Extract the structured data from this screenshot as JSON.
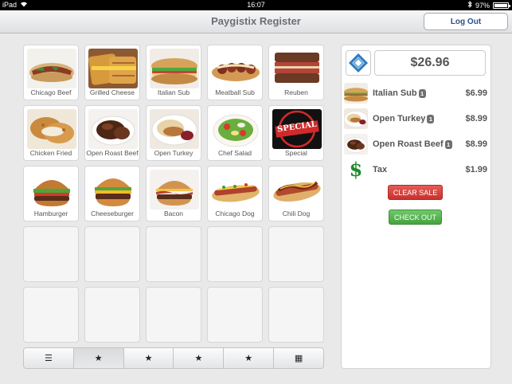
{
  "status_bar": {
    "device": "iPad",
    "time": "16:07",
    "battery": "97%",
    "battery_level": 0.97
  },
  "nav": {
    "title": "Paygistix Register",
    "logout_label": "Log Out"
  },
  "products": [
    {
      "label": "Chicago Beef",
      "image": "chicago-beef"
    },
    {
      "label": "Grilled Cheese",
      "image": "grilled-cheese"
    },
    {
      "label": "Italian Sub",
      "image": "italian-sub"
    },
    {
      "label": "Meatball Sub",
      "image": "meatball-sub"
    },
    {
      "label": "Reuben",
      "image": "reuben"
    },
    {
      "label": "Chicken Fried",
      "image": "chicken-fried"
    },
    {
      "label": "Open Roast Beef",
      "image": "open-roast-beef"
    },
    {
      "label": "Open Turkey",
      "image": "open-turkey"
    },
    {
      "label": "Chef Salad",
      "image": "chef-salad"
    },
    {
      "label": "Special",
      "image": "special-stamp"
    },
    {
      "label": "Hamburger",
      "image": "hamburger"
    },
    {
      "label": "Cheeseburger",
      "image": "cheeseburger"
    },
    {
      "label": "Bacon",
      "image": "bacon-burger"
    },
    {
      "label": "Chicago Dog",
      "image": "chicago-dog"
    },
    {
      "label": "Chili Dog",
      "image": "chili-dog"
    }
  ],
  "special_stamp_text": "SPECIAL",
  "tabs": [
    {
      "glyph": "☰",
      "icon": "list-icon",
      "active": false
    },
    {
      "glyph": "★",
      "icon": "star-icon",
      "active": true
    },
    {
      "glyph": "★",
      "icon": "star-icon",
      "active": false
    },
    {
      "glyph": "★",
      "icon": "star-icon",
      "active": false
    },
    {
      "glyph": "★",
      "icon": "star-icon",
      "active": false
    },
    {
      "glyph": "▦",
      "icon": "grid-icon",
      "active": false
    }
  ],
  "sale": {
    "total": "$26.96",
    "items": [
      {
        "name": "Italian Sub",
        "qty": "1",
        "price": "$6.99",
        "image": "italian-sub"
      },
      {
        "name": "Open Turkey",
        "qty": "1",
        "price": "$8.99",
        "image": "open-turkey"
      },
      {
        "name": "Open Roast Beef",
        "qty": "1",
        "price": "$8.99",
        "image": "open-roast-beef"
      },
      {
        "name": "Tax",
        "qty": "",
        "price": "$1.99",
        "image": "dollar-sign"
      }
    ],
    "tax_symbol": "$",
    "clear_label": "CLEAR SALE",
    "checkout_label": "CHECK OUT"
  },
  "colors": {
    "clear_button": "#d9433e",
    "checkout_button": "#56b450",
    "logo_blue": "#2f7bbf"
  }
}
